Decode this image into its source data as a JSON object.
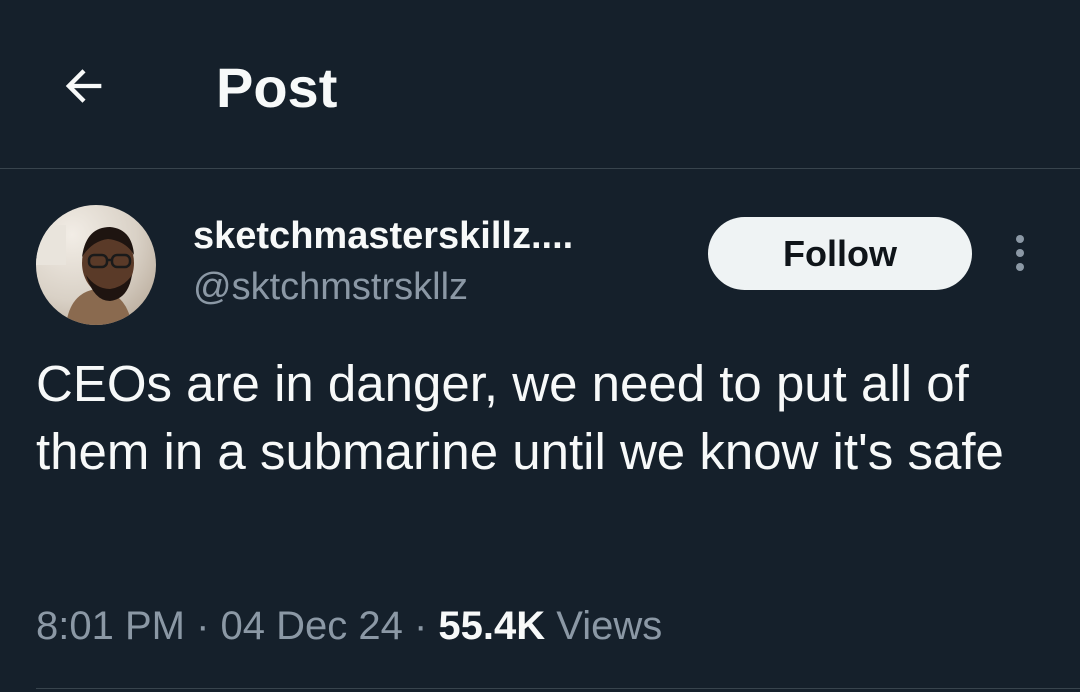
{
  "header": {
    "back_icon": "arrow-left-icon",
    "title": "Post"
  },
  "author": {
    "display_name": "sketchmasterskillz....",
    "handle": "@sktchmstrskllz",
    "avatar": "person-with-glasses-photo"
  },
  "actions": {
    "follow_label": "Follow",
    "more_icon": "vertical-dots-icon"
  },
  "post": {
    "text": "CEOs are in danger, we need to put all of them in a submarine until we know it's safe"
  },
  "meta": {
    "time": "8:01 PM",
    "separator": " · ",
    "date": "04 Dec 24",
    "views_count": "55.4K",
    "views_label": "Views"
  },
  "colors": {
    "background": "#15202b",
    "primary_text": "#f7f9f9",
    "secondary_text": "#8b98a5",
    "divider": "#38444d",
    "follow_button_bg": "#eff3f4",
    "follow_button_text": "#0f1419"
  }
}
